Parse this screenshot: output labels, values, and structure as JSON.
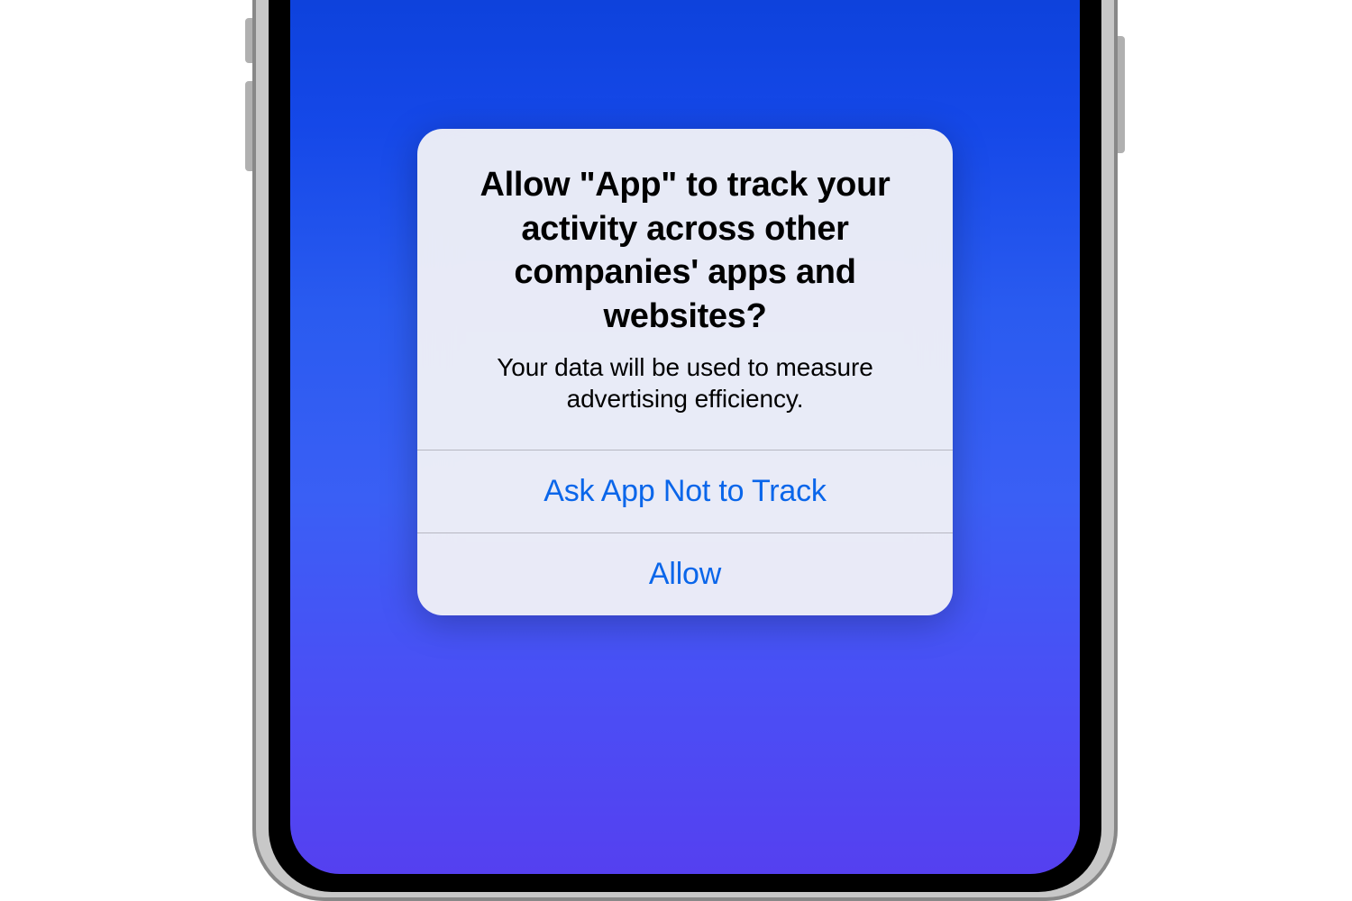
{
  "dialog": {
    "title": "Allow \"App\" to track your activity across other companies' apps and websites?",
    "message": "Your data will be used to measure advertising efficiency.",
    "buttons": {
      "deny": "Ask App Not to Track",
      "allow": "Allow"
    }
  }
}
